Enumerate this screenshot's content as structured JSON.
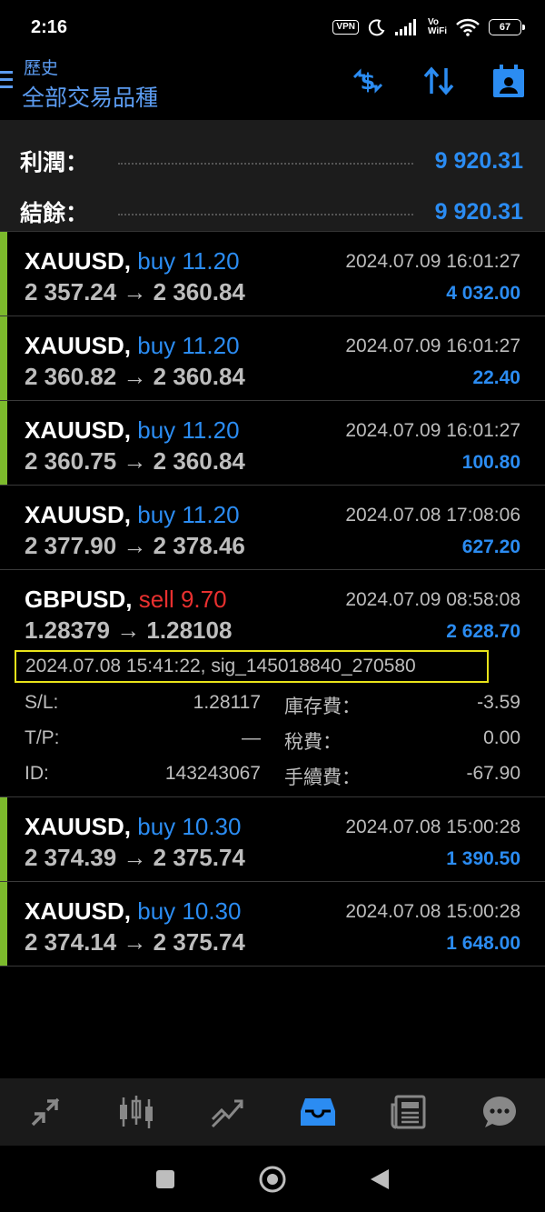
{
  "status_bar": {
    "time": "2:16",
    "vpn": "VPN",
    "volte_top": "Vo",
    "volte_bottom": "WiFi",
    "battery": "67"
  },
  "header": {
    "subtitle": "歷史",
    "title": "全部交易品種",
    "icons": [
      "currency-exchange-icon",
      "sort-icon",
      "calendar-icon"
    ]
  },
  "summary": {
    "profit_label": "利潤：",
    "profit_value": "9 920.31",
    "balance_label": "結餘：",
    "balance_value": "9 920.31"
  },
  "deals": [
    {
      "symbol": "XAUUSD,",
      "type": "buy 11.20",
      "prices": "2 357.24 → 2 360.84",
      "time": "2024.07.09 16:01:27",
      "profit": "4 032.00"
    },
    {
      "symbol": "XAUUSD,",
      "type": "buy 11.20",
      "prices": "2 360.82 → 2 360.84",
      "time": "2024.07.09 16:01:27",
      "profit": "22.40"
    },
    {
      "symbol": "XAUUSD,",
      "type": "buy 11.20",
      "prices": "2 360.75 → 2 360.84",
      "time": "2024.07.09 16:01:27",
      "profit": "100.80"
    },
    {
      "symbol": "XAUUSD,",
      "type": "buy 11.20",
      "prices": "2 377.90 → 2 378.46",
      "time": "2024.07.08 17:08:06",
      "profit": "627.20"
    },
    {
      "symbol": "GBPUSD,",
      "type": "sell 9.70",
      "prices": "1.28379 → 1.28108",
      "time": "2024.07.09 08:58:08",
      "profit": "2 628.70",
      "comment": "2024.07.08 15:41:22, sig_145018840_270580",
      "sl_label": "S/L:",
      "sl_value": "1.28117",
      "tp_label": "T/P:",
      "tp_value": "—",
      "id_label": "ID:",
      "id_value": "143243067",
      "swap_label": "庫存費：",
      "swap_value": "-3.59",
      "tax_label": "稅費：",
      "tax_value": "0.00",
      "commission_label": "手續費：",
      "commission_value": "-67.90"
    },
    {
      "symbol": "XAUUSD,",
      "type": "buy 10.30",
      "prices": "2 374.39 → 2 375.74",
      "time": "2024.07.08 15:00:28",
      "profit": "1 390.50"
    },
    {
      "symbol": "XAUUSD,",
      "type": "buy 10.30",
      "prices": "2 374.14 → 2 375.74",
      "time": "2024.07.08 15:00:28",
      "profit": "1 648.00"
    }
  ],
  "colors": {
    "accent_blue": "#2b8cf2",
    "header_blue": "#5b9bf0",
    "buy_accent": "#7cba2c",
    "sell_red": "#e8302f",
    "comment_border": "#e9e31a"
  },
  "bottom_nav": [
    "quotes-icon",
    "chart-icon",
    "trade-icon",
    "history-icon",
    "news-icon",
    "chat-icon"
  ],
  "bottom_nav_active": "history-icon"
}
